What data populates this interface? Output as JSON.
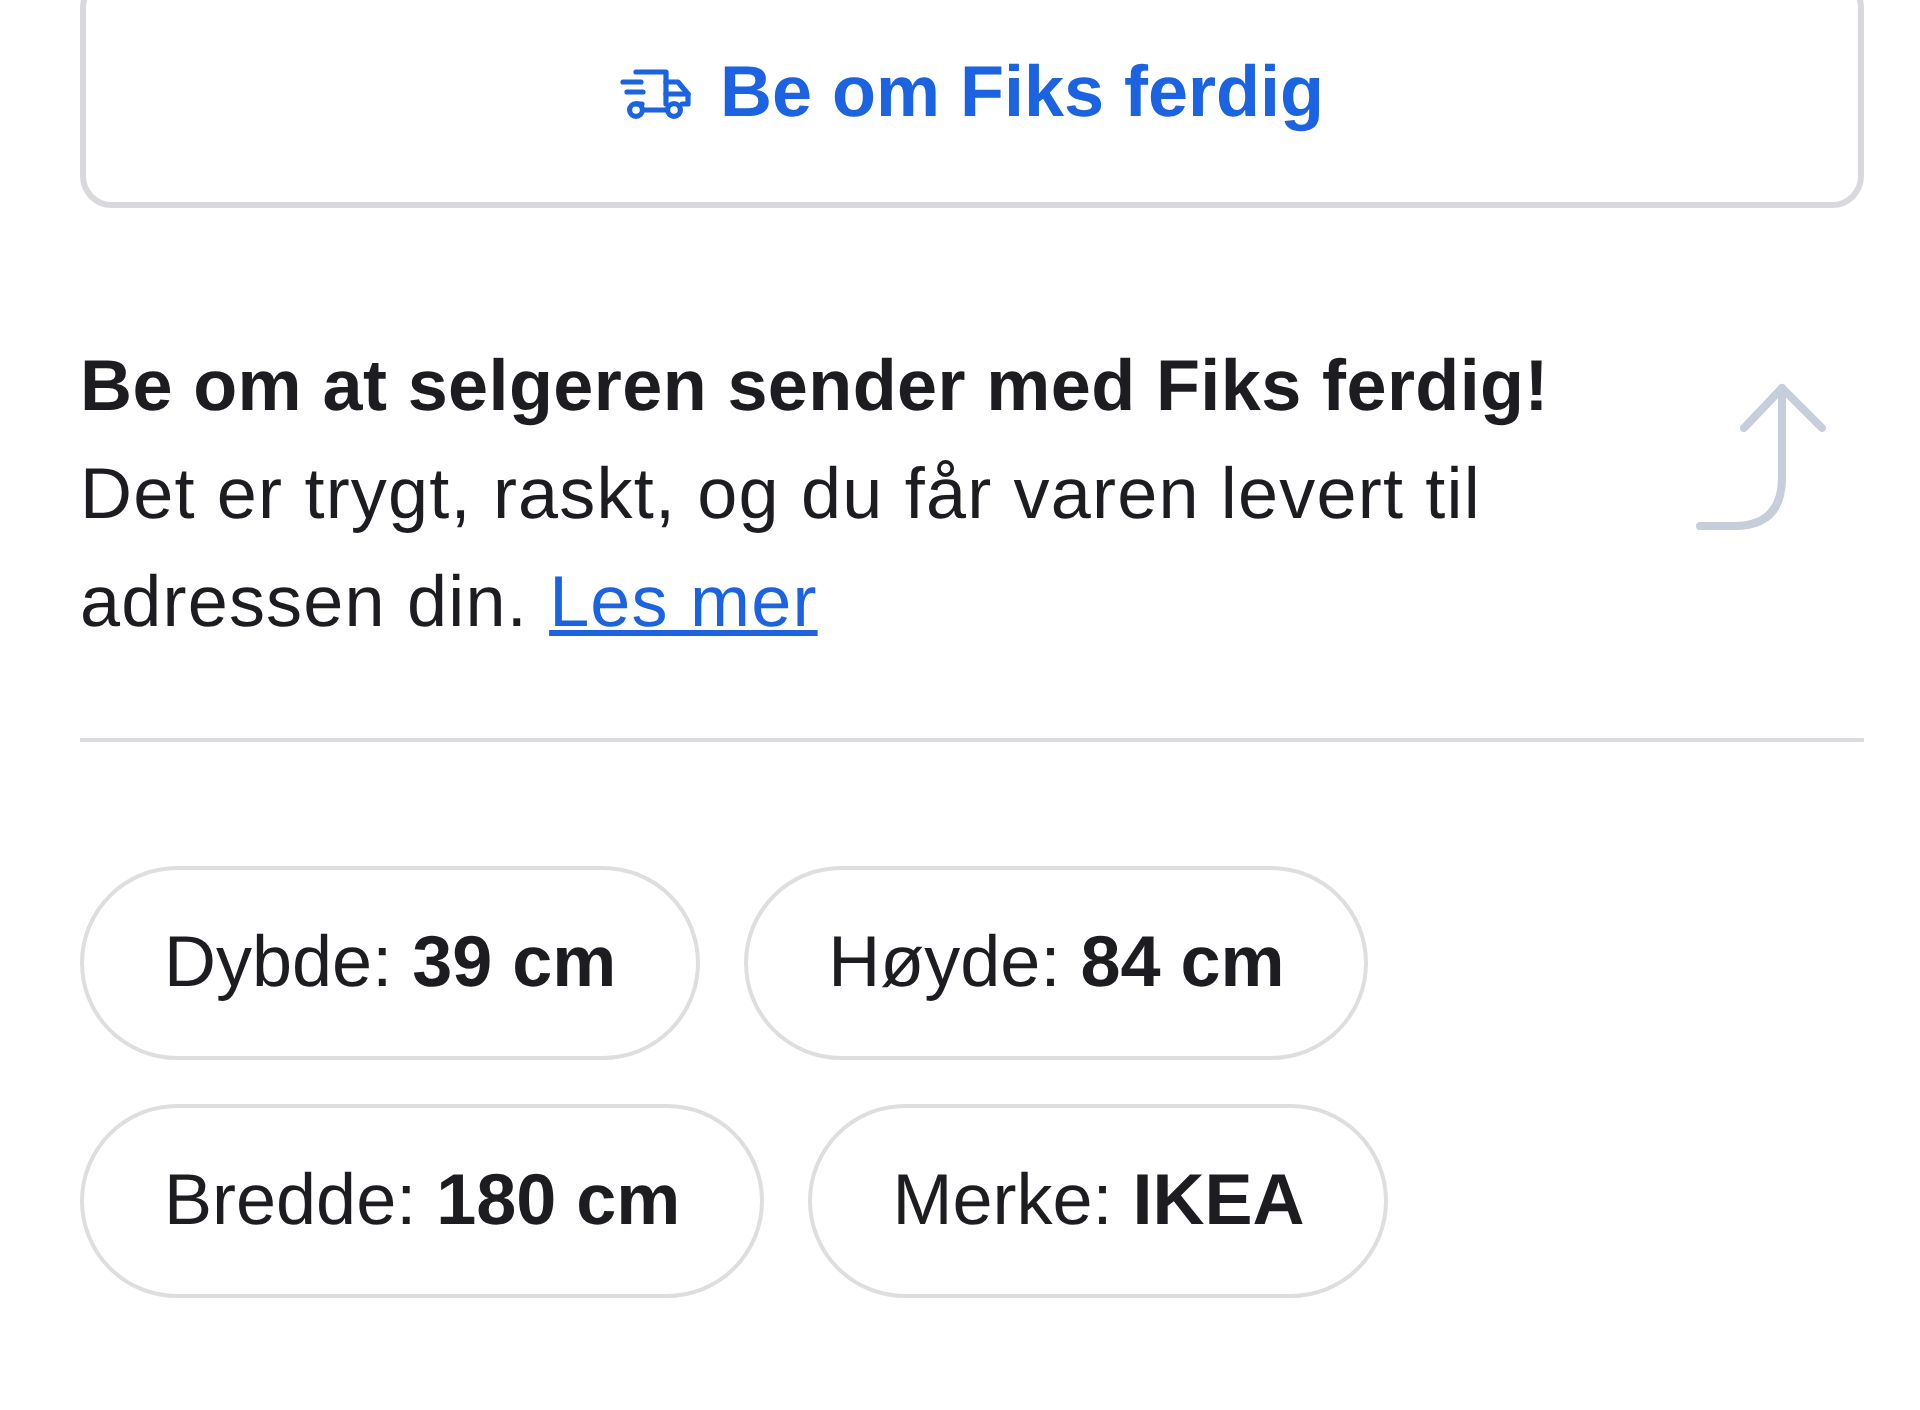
{
  "request_button": {
    "label": "Be om Fiks ferdig"
  },
  "promo": {
    "heading": "Be om at selgeren sender med Fiks ferdig!",
    "text": "Det er trygt, raskt, og du får varen levert til adressen din.",
    "link": "Les mer"
  },
  "specs": [
    "Dybde: **39 cm**",
    "Høyde: **84 cm**",
    "Bredde: **180 cm**",
    "Merke: **IKEA**"
  ]
}
